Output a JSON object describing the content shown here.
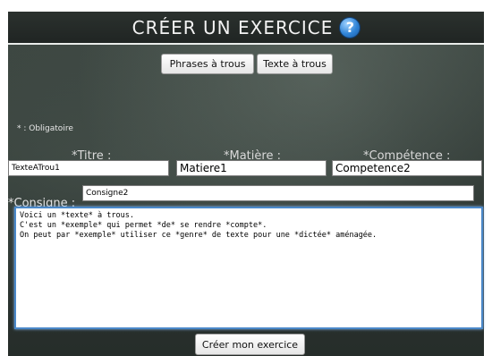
{
  "header": {
    "title": "CRÉER UN EXERCICE",
    "help_icon": "help-icon",
    "help_glyph": "?"
  },
  "tabs": [
    {
      "label": "Phrases à trous"
    },
    {
      "label": "Texte à trous"
    }
  ],
  "form": {
    "mandatory_note": "* : Obligatoire",
    "labels": {
      "titre": "*Titre :",
      "matiere": "*Matière :",
      "competence": "*Compétence :",
      "consigne": "*Consigne :"
    },
    "values": {
      "titre": "TexteATrou1",
      "matiere": "Matiere1",
      "competence": "Competence2",
      "consigne": "Consigne2"
    },
    "text_lines": [
      "Voici un *texte* à trous.",
      "C'est un *exemple* qui permet *de* se rendre *compte*.",
      "On peut par *exemple* utiliser ce *genre* de texte pour une *dictée* aménagée."
    ]
  },
  "footer": {
    "submit_label": "Créer mon exercice"
  },
  "colors": {
    "accent": "#4a88c9",
    "board": "#2f3834"
  }
}
